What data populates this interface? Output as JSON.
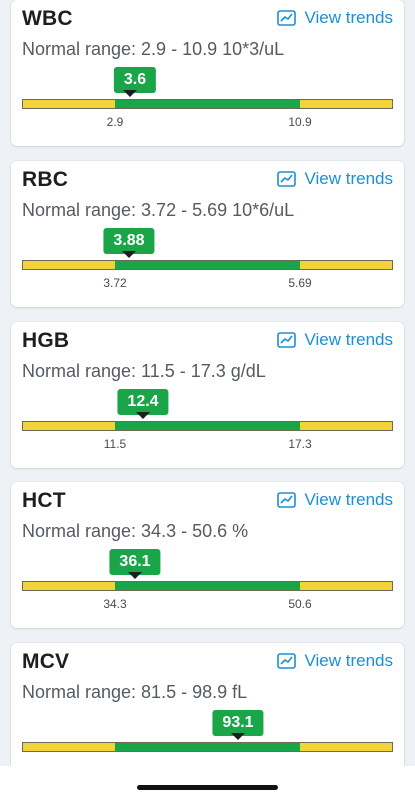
{
  "cards": [
    {
      "title": "WBC",
      "trend_label": "View trends",
      "range_text": "Normal range: 2.9 - 10.9 10*3/uL",
      "value": "3.6",
      "low": "2.9",
      "high": "10.9"
    },
    {
      "title": "RBC",
      "trend_label": "View trends",
      "range_text": "Normal range: 3.72 - 5.69 10*6/uL",
      "value": "3.88",
      "low": "3.72",
      "high": "5.69"
    },
    {
      "title": "HGB",
      "trend_label": "View trends",
      "range_text": "Normal range: 11.5 - 17.3 g/dL",
      "value": "12.4",
      "low": "11.5",
      "high": "17.3"
    },
    {
      "title": "HCT",
      "trend_label": "View trends",
      "range_text": "Normal range: 34.3 - 50.6 %",
      "value": "36.1",
      "low": "34.3",
      "high": "50.6"
    },
    {
      "title": "MCV",
      "trend_label": "View trends",
      "range_text": "Normal range: 81.5 - 98.9 fL",
      "value": "93.1",
      "low": "81.5",
      "high": "98.9"
    }
  ],
  "colors": {
    "accent": "#1b8fd3",
    "in_range": "#1aa648",
    "out_of_range": "#f2d43a"
  },
  "icons": {
    "trend": "trend-chart-icon",
    "marker": "triangle-pointer-icon"
  }
}
